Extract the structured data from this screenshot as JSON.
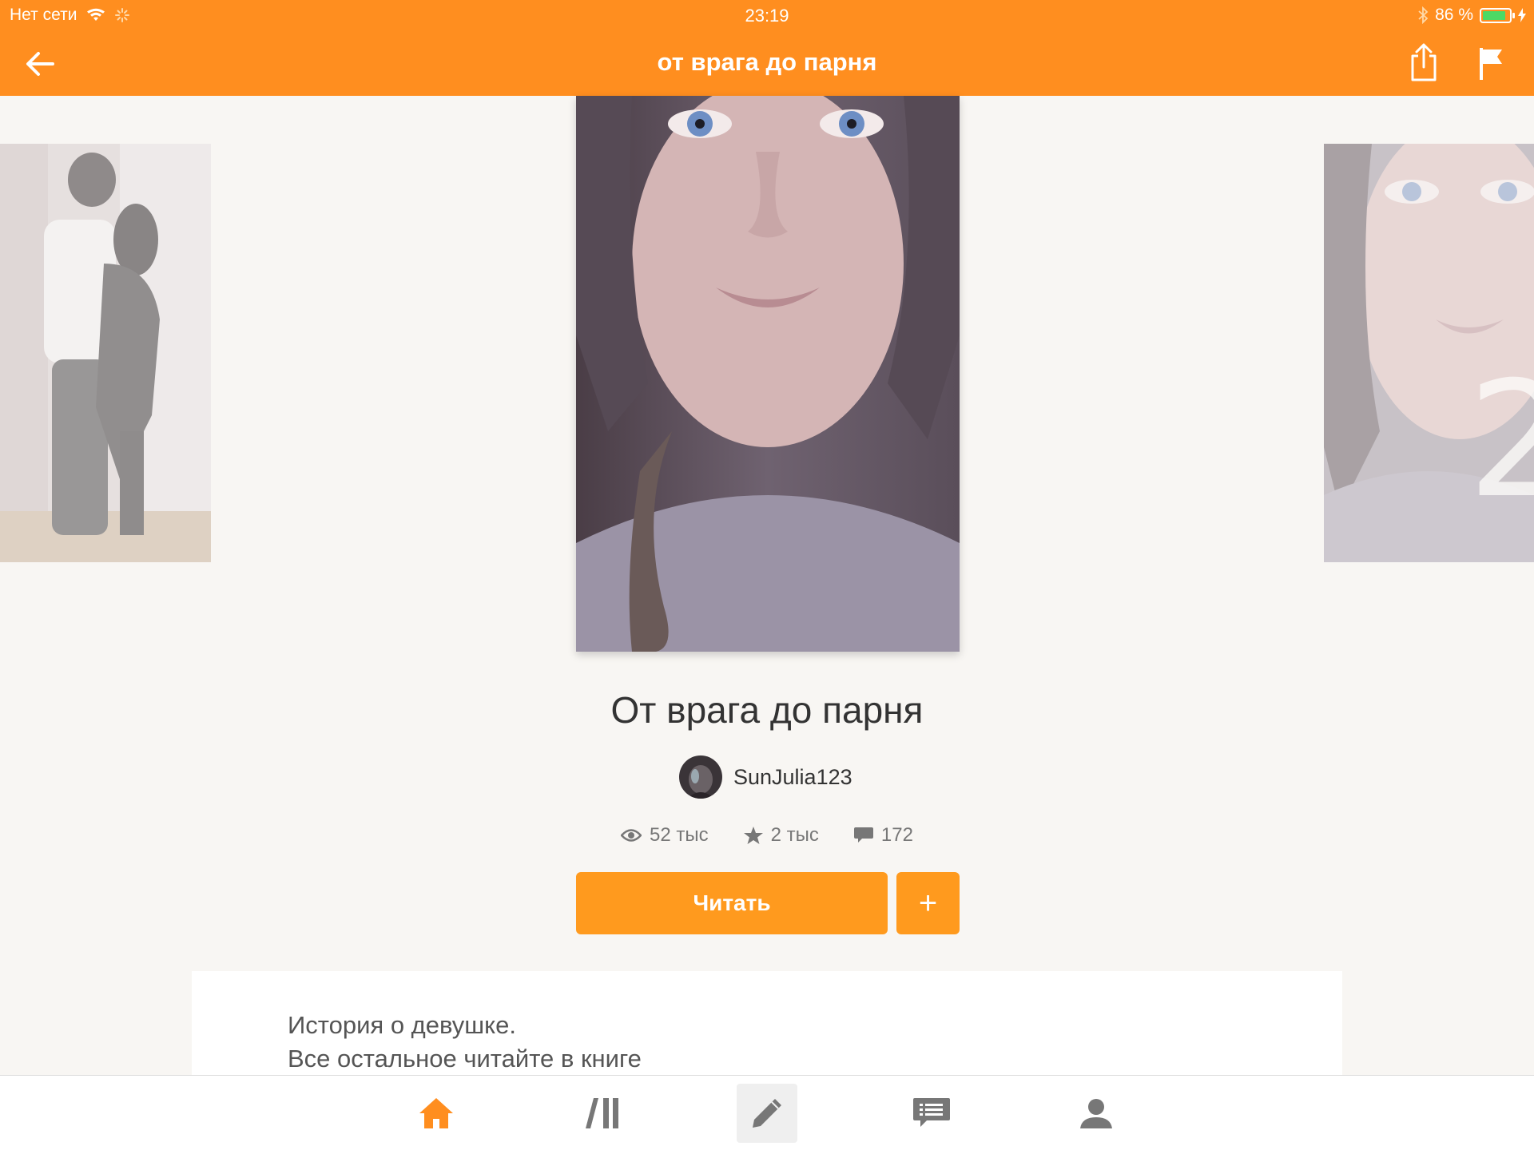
{
  "status_bar": {
    "carrier": "Нет сети",
    "time": "23:19",
    "battery": "86 %"
  },
  "nav": {
    "title": "от врага до парня"
  },
  "story": {
    "title": "От врага до парня",
    "author": "SunJulia123",
    "stats": {
      "reads": "52 тыс",
      "votes": "2 тыс",
      "comments": "172"
    },
    "read_label": "Читать",
    "add_label": "+",
    "description_line1": "История о девушке.",
    "description_line2": "Все остальное читайте в книге"
  },
  "colors": {
    "accent": "#ff8e1f",
    "button": "#ff9a1e",
    "background": "#f8f6f3"
  },
  "icons": {
    "back": "arrow-left-icon",
    "share": "share-icon",
    "report": "flag-icon",
    "reads": "eye-icon",
    "votes": "star-icon",
    "comments": "comment-icon",
    "tabs": [
      "home-icon",
      "library-icon",
      "write-icon",
      "messages-icon",
      "profile-icon"
    ]
  }
}
